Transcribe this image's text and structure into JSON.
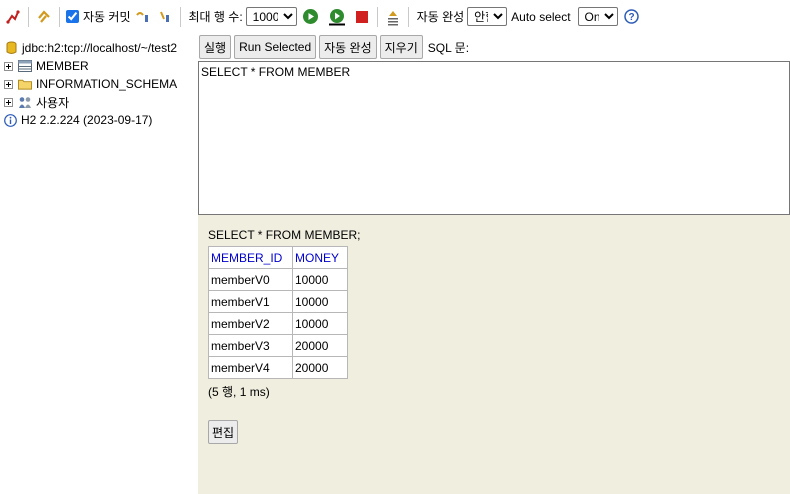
{
  "toolbar": {
    "autocommit_label": "자동 커밋",
    "autocommit_checked": true,
    "max_rows_label": "최대 행 수:",
    "max_rows_value": "1000",
    "autocomplete_label": "자동 완성",
    "autocomplete_value": "안함",
    "autoselect_label": "Auto select",
    "autoselect_value": "On"
  },
  "tree": {
    "connection": "jdbc:h2:tcp://localhost/~/test2",
    "items": [
      {
        "label": "MEMBER",
        "icon": "table-icon"
      },
      {
        "label": "INFORMATION_SCHEMA",
        "icon": "folder-icon"
      },
      {
        "label": "사용자",
        "icon": "users-icon"
      }
    ],
    "version": "H2 2.2.224 (2023-09-17)"
  },
  "commands": {
    "run": "실행",
    "run_selected": "Run Selected",
    "autocomplete": "자동 완성",
    "clear": "지우기",
    "sql_label": "SQL 문:"
  },
  "editor": {
    "sql": "SELECT * FROM MEMBER"
  },
  "result": {
    "statement": "SELECT * FROM MEMBER;",
    "columns": [
      "MEMBER_ID",
      "MONEY"
    ],
    "rows": [
      [
        "memberV0",
        "10000"
      ],
      [
        "memberV1",
        "10000"
      ],
      [
        "memberV2",
        "10000"
      ],
      [
        "memberV3",
        "20000"
      ],
      [
        "memberV4",
        "20000"
      ]
    ],
    "summary": "(5 행, 1 ms)",
    "edit_label": "편집"
  }
}
